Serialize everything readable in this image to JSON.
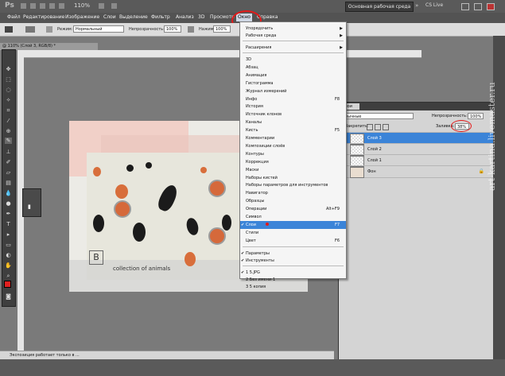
{
  "app_bar": {
    "logo": "Ps",
    "zoom": "110%",
    "workspace_button": "Основная рабочая среда",
    "cslive": "CS Live"
  },
  "menu": [
    "Файл",
    "Редактирование",
    "Изображение",
    "Слои",
    "Выделение",
    "Фильтр",
    "Анализ",
    "3D",
    "Просмотр",
    "Окно",
    "Справка"
  ],
  "options_bar": {
    "mode_label": "Режим:",
    "mode_value": "Нормальный",
    "opacity_label": "Непрозрачность:",
    "opacity_value": "100%",
    "flow_label": "Нажим:",
    "flow_value": "100%"
  },
  "document_tab": "@ 110% (Слой 3, RGB/8) *",
  "image_text": "collection of animals",
  "window_menu": {
    "groups": [
      [
        {
          "label": "Упорядочить",
          "submenu": true
        },
        {
          "label": "Рабочая среда",
          "submenu": true
        }
      ],
      [
        {
          "label": "Расширения",
          "submenu": true
        }
      ],
      [
        {
          "label": "3D"
        },
        {
          "label": "Абзац"
        },
        {
          "label": "Анимация"
        },
        {
          "label": "Гистограмма"
        },
        {
          "label": "Журнал измерений"
        },
        {
          "label": "Инфо",
          "shortcut": "F8"
        },
        {
          "label": "История"
        },
        {
          "label": "Источник клонов"
        },
        {
          "label": "Каналы"
        },
        {
          "label": "Кисть",
          "shortcut": "F5"
        },
        {
          "label": "Комментарии"
        },
        {
          "label": "Композиции слоёв"
        },
        {
          "label": "Контуры"
        },
        {
          "label": "Коррекция"
        },
        {
          "label": "Маски"
        },
        {
          "label": "Наборы кистей"
        },
        {
          "label": "Наборы параметров для инструментов"
        },
        {
          "label": "Навигатор"
        },
        {
          "label": "Образцы"
        },
        {
          "label": "Операции",
          "shortcut": "Alt+F9"
        },
        {
          "label": "Символ"
        },
        {
          "label": "Слои",
          "shortcut": "F7",
          "checked": true,
          "highlight": true
        },
        {
          "label": "Стили"
        },
        {
          "label": "Цвет",
          "shortcut": "F6"
        }
      ],
      [
        {
          "label": "Параметры",
          "checked": true
        },
        {
          "label": "Инструменты",
          "checked": true
        }
      ],
      [
        {
          "label": "1 5.JPG",
          "checked": true
        },
        {
          "label": "2 Без имени-1"
        },
        {
          "label": "3 5 копия"
        }
      ]
    ]
  },
  "layers_panel": {
    "tab": "Слои",
    "blend": "обычные",
    "opacity_label": "Непрозрачность:",
    "opacity_value": "100%",
    "lock_label": "Закрепить:",
    "fill_label": "Заливка:",
    "fill_value": "38%",
    "layers": [
      {
        "name": "Слой 3",
        "selected": true
      },
      {
        "name": "Слой 2"
      },
      {
        "name": "Слой 1"
      },
      {
        "name": "Фон",
        "locked": true
      }
    ]
  },
  "status_bar": "Экспозиция работает только в ...",
  "watermark": "art-kartina.livemaster.ru",
  "colors": {
    "accent": "#3b84d8",
    "annotation": "#e21a1a",
    "foreground": "#e02020",
    "background": "#ffffff"
  }
}
